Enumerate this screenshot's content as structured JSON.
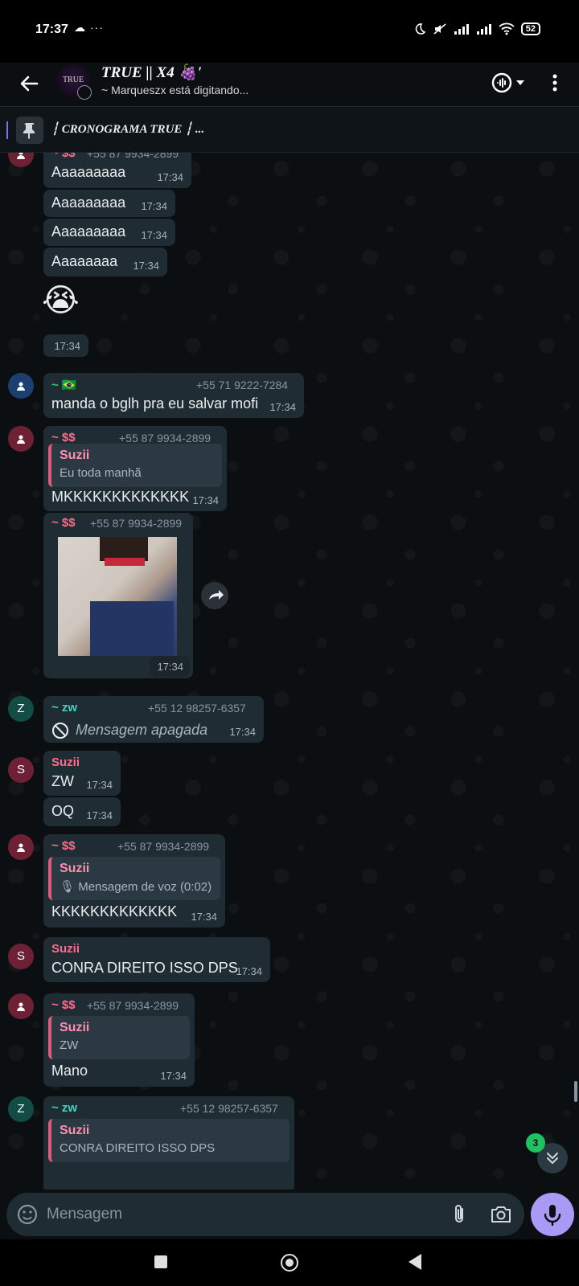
{
  "status_bar": {
    "time": "17:37",
    "extra": "☁ ···",
    "battery": "52"
  },
  "header": {
    "avatar_text": "TRUE",
    "title": "TRUE || X4 🍇'",
    "typing": "~ Marqueszx está digitando..."
  },
  "pinned": {
    "text": "┆ CRONOGRAMA TRUE ┆ ..."
  },
  "messages": [
    {
      "sender": "~ $$",
      "phone": "+55 87 9934-2899",
      "text": "Aaaaaaaaa",
      "time": "17:34"
    },
    {
      "text": "Aaaaaaaaa",
      "time": "17:34"
    },
    {
      "text": "Aaaaaaaaa",
      "time": "17:34"
    },
    {
      "text": "Aaaaaaaa",
      "time": "17:34"
    },
    {
      "text": "😭",
      "time": "17:34"
    },
    {
      "sender": "~ 🇧🇷",
      "phone": "+55 71 9222-7284",
      "text": "manda o bglh pra eu salvar mofi",
      "time": "17:34"
    },
    {
      "sender": "~ $$",
      "phone": "+55 87 9934-2899",
      "quote_name": "Suzii",
      "quote_text": "Eu toda manhã",
      "text": "MKKKKKKKKKKKKK",
      "time": "17:34"
    },
    {
      "sender": "~ $$",
      "phone": "+55 87 9934-2899",
      "time": "17:34"
    },
    {
      "sender": "~ zw",
      "phone": "+55 12 98257-6357",
      "text": "Mensagem apagada",
      "time": "17:34"
    },
    {
      "sender": "Suzii",
      "text": "ZW",
      "time": "17:34"
    },
    {
      "text": "OQ",
      "time": "17:34"
    },
    {
      "sender": "~ $$",
      "phone": "+55 87 9934-2899",
      "quote_name": "Suzii",
      "quote_text": "🎙 Mensagem de voz (0:02)",
      "text": "KKKKKKKKKKKKK",
      "time": "17:34"
    },
    {
      "sender": "Suzii",
      "text": "CONRA DIREITO ISSO DPS",
      "time": "17:34"
    },
    {
      "sender": "~ $$",
      "phone": "+55 87 9934-2899",
      "quote_name": "Suzii",
      "quote_text": "ZW",
      "text": "Mano",
      "time": "17:34"
    },
    {
      "sender": "~ zw",
      "phone": "+55 12 98257-6357",
      "quote_name": "Suzii",
      "quote_text": "CONRA DIREITO ISSO DPS"
    }
  ],
  "avatars": {
    "z": "Z",
    "s": "S"
  },
  "composer": {
    "placeholder": "Mensagem"
  },
  "scroll": {
    "unread_count": "3"
  },
  "colors": {
    "sender_red": "#ff6b8b",
    "sender_green": "#25d366",
    "sender_teal": "#3ed6c0",
    "accent": "#a99bf5"
  }
}
